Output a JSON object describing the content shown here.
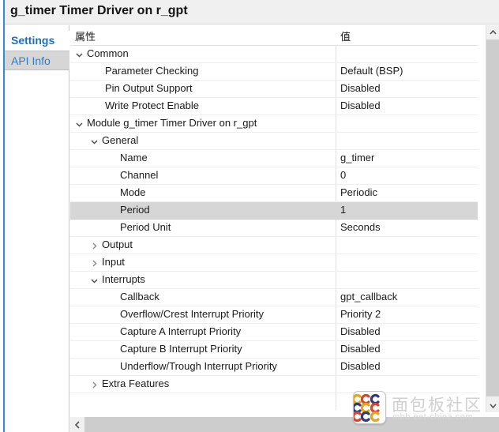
{
  "window": {
    "title": "g_timer Timer Driver on r_gpt",
    "accent_color": "#2e8fd8"
  },
  "tabs": [
    {
      "label": "Settings",
      "active": true
    },
    {
      "label": "API Info",
      "active": false
    }
  ],
  "table": {
    "headers": {
      "property": "属性",
      "value": "值"
    },
    "rows": [
      {
        "indent": 0,
        "twisty": "expanded",
        "property": "Common",
        "value": "",
        "selected": false
      },
      {
        "indent": 2,
        "twisty": "none",
        "property": "Parameter Checking",
        "value": "Default (BSP)",
        "selected": false
      },
      {
        "indent": 2,
        "twisty": "none",
        "property": "Pin Output Support",
        "value": "Disabled",
        "selected": false
      },
      {
        "indent": 2,
        "twisty": "none",
        "property": "Write Protect Enable",
        "value": "Disabled",
        "selected": false
      },
      {
        "indent": 0,
        "twisty": "expanded",
        "property": "Module g_timer Timer Driver on r_gpt",
        "value": "",
        "selected": false
      },
      {
        "indent": 1,
        "twisty": "expanded",
        "property": "General",
        "value": "",
        "selected": false
      },
      {
        "indent": 3,
        "twisty": "none",
        "property": "Name",
        "value": "g_timer",
        "selected": false
      },
      {
        "indent": 3,
        "twisty": "none",
        "property": "Channel",
        "value": "0",
        "selected": false
      },
      {
        "indent": 3,
        "twisty": "none",
        "property": "Mode",
        "value": "Periodic",
        "selected": false
      },
      {
        "indent": 3,
        "twisty": "none",
        "property": "Period",
        "value": "1",
        "selected": true
      },
      {
        "indent": 3,
        "twisty": "none",
        "property": "Period Unit",
        "value": "Seconds",
        "selected": false
      },
      {
        "indent": 1,
        "twisty": "collapsed",
        "property": "Output",
        "value": "",
        "selected": false
      },
      {
        "indent": 1,
        "twisty": "collapsed",
        "property": "Input",
        "value": "",
        "selected": false
      },
      {
        "indent": 1,
        "twisty": "expanded",
        "property": "Interrupts",
        "value": "",
        "selected": false
      },
      {
        "indent": 3,
        "twisty": "none",
        "property": "Callback",
        "value": "gpt_callback",
        "selected": false
      },
      {
        "indent": 3,
        "twisty": "none",
        "property": "Overflow/Crest Interrupt Priority",
        "value": "Priority 2",
        "selected": false
      },
      {
        "indent": 3,
        "twisty": "none",
        "property": "Capture A Interrupt Priority",
        "value": "Disabled",
        "selected": false
      },
      {
        "indent": 3,
        "twisty": "none",
        "property": "Capture B Interrupt Priority",
        "value": "Disabled",
        "selected": false
      },
      {
        "indent": 3,
        "twisty": "none",
        "property": "Underflow/Trough Interrupt Priority",
        "value": "Disabled",
        "selected": false
      },
      {
        "indent": 1,
        "twisty": "collapsed",
        "property": "Extra Features",
        "value": "",
        "selected": false
      }
    ]
  },
  "scrollbars": {
    "vertical": {
      "up_arrow": "chevron-up-icon",
      "down_arrow": "chevron-down-icon"
    },
    "horizontal": {
      "left_arrow": "chevron-left-icon"
    }
  },
  "watermark": {
    "site_name": "面包板社区",
    "url": "mbb.eet-china.com",
    "logo_colors": [
      "#d8452f",
      "#e8a317",
      "#2e3d7a"
    ]
  }
}
